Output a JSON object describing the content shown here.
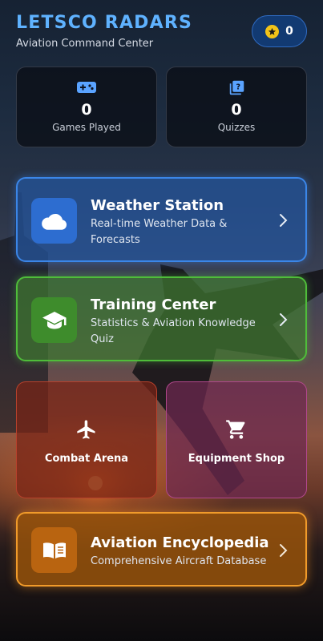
{
  "header": {
    "title": "LETSCO RADARS",
    "subtitle": "Aviation Command Center",
    "coins": "0"
  },
  "stats": [
    {
      "icon": "gamepad-icon",
      "value": "0",
      "label": "Games Played"
    },
    {
      "icon": "quiz-icon",
      "value": "0",
      "label": "Quizzes"
    }
  ],
  "features": {
    "weather": {
      "icon": "cloud-icon",
      "title": "Weather Station",
      "desc": "Real-time Weather Data & Forecasts"
    },
    "training": {
      "icon": "graduation-cap-icon",
      "title": "Training Center",
      "desc": "Statistics & Aviation Knowledge Quiz"
    },
    "combat": {
      "icon": "airplane-icon",
      "label": "Combat Arena"
    },
    "shop": {
      "icon": "shopping-cart-icon",
      "label": "Equipment Shop"
    },
    "encyclopedia": {
      "icon": "book-icon",
      "title": "Aviation Encyclopedia",
      "desc": "Comprehensive Aircraft Database"
    }
  },
  "colors": {
    "title_blue": "#5fb2ff",
    "coin_gold": "#f2c318",
    "weather_blue": "#3b86e8",
    "training_green": "#4fbd3a",
    "combat_red": "#b8412c",
    "shop_magenta": "#b1488c",
    "encyclopedia_orange": "#f19b2a"
  }
}
